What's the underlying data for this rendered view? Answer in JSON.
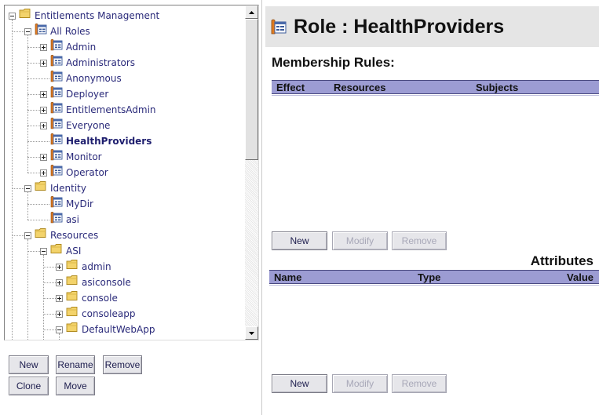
{
  "tree": {
    "items": [
      {
        "label": "Entitlements Management",
        "icon": "folder-icon",
        "expander": "minus",
        "depth": 0
      },
      {
        "label": "All Roles",
        "icon": "role-icon",
        "expander": "minus",
        "depth": 1
      },
      {
        "label": "Admin",
        "icon": "role-icon",
        "expander": "plus",
        "depth": 2
      },
      {
        "label": "Administrators",
        "icon": "role-icon",
        "expander": "plus",
        "depth": 2
      },
      {
        "label": "Anonymous",
        "icon": "role-icon",
        "expander": "none",
        "depth": 2
      },
      {
        "label": "Deployer",
        "icon": "role-icon",
        "expander": "plus",
        "depth": 2
      },
      {
        "label": "EntitlementsAdmin",
        "icon": "role-icon",
        "expander": "plus",
        "depth": 2
      },
      {
        "label": "Everyone",
        "icon": "role-icon",
        "expander": "plus",
        "depth": 2
      },
      {
        "label": "HealthProviders",
        "icon": "role-icon",
        "expander": "none",
        "depth": 2,
        "selected": true
      },
      {
        "label": "Monitor",
        "icon": "role-icon",
        "expander": "plus",
        "depth": 2
      },
      {
        "label": "Operator",
        "icon": "role-icon",
        "expander": "plus",
        "depth": 2
      },
      {
        "label": "Identity",
        "icon": "folder-icon",
        "expander": "minus",
        "depth": 1
      },
      {
        "label": "MyDir",
        "icon": "role-icon",
        "expander": "none",
        "depth": 2
      },
      {
        "label": "asi",
        "icon": "role-icon",
        "expander": "none",
        "depth": 2
      },
      {
        "label": "Resources",
        "icon": "folder-icon",
        "expander": "minus",
        "depth": 1
      },
      {
        "label": "ASI",
        "icon": "folder-icon",
        "expander": "minus",
        "depth": 2
      },
      {
        "label": "admin",
        "icon": "folder-icon",
        "expander": "plus",
        "depth": 3
      },
      {
        "label": "asiconsole",
        "icon": "folder-icon",
        "expander": "plus",
        "depth": 3
      },
      {
        "label": "console",
        "icon": "folder-icon",
        "expander": "plus",
        "depth": 3
      },
      {
        "label": "consoleapp",
        "icon": "folder-icon",
        "expander": "plus",
        "depth": 3
      },
      {
        "label": "DefaultWebApp",
        "icon": "folder-icon",
        "expander": "minus",
        "depth": 3
      }
    ]
  },
  "tree_buttons": {
    "new": "New",
    "rename": "Rename",
    "remove": "Remove",
    "clone": "Clone",
    "move": "Move"
  },
  "role": {
    "title": "Role : HealthProviders"
  },
  "membership": {
    "heading": "Membership Rules:",
    "columns": [
      "Effect",
      "Resources",
      "Subjects"
    ],
    "buttons": {
      "new": "New",
      "modify": "Modify",
      "remove": "Remove"
    }
  },
  "attributes": {
    "heading": "Attributes",
    "columns": [
      "Name",
      "Type",
      "Value"
    ],
    "buttons": {
      "new": "New",
      "modify": "Modify",
      "remove": "Remove"
    }
  },
  "colors": {
    "grid_header": "#9c9cd3",
    "title_bar": "#e5e5e5",
    "tree_text": "#2a2a7a",
    "folder": "#f3d36b",
    "role_icon_accent": "#e07b20"
  }
}
